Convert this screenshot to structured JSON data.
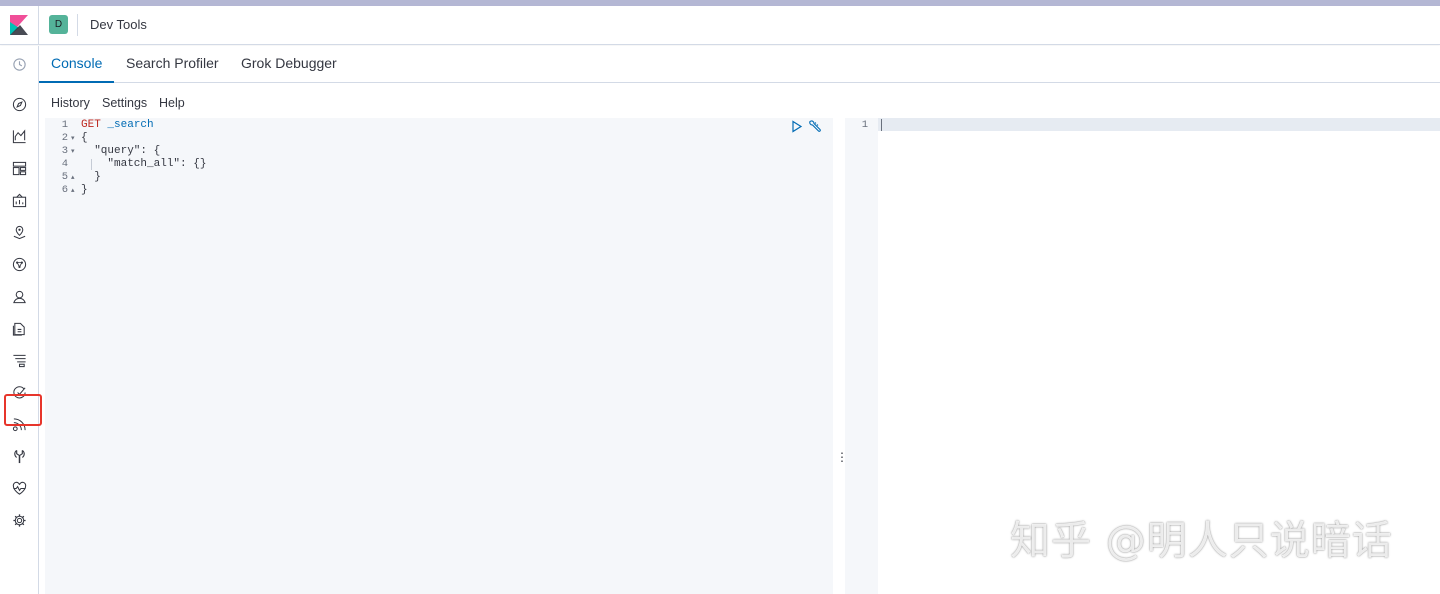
{
  "header": {
    "space_avatar": "D",
    "breadcrumb": "Dev Tools"
  },
  "sidenav": {
    "items": [
      {
        "icon": "recently-viewed-icon"
      },
      {
        "icon": "discover-icon"
      },
      {
        "icon": "visualize-icon"
      },
      {
        "icon": "dashboard-icon"
      },
      {
        "icon": "canvas-icon"
      },
      {
        "icon": "maps-icon"
      },
      {
        "icon": "ml-icon"
      },
      {
        "icon": "infrastructure-icon"
      },
      {
        "icon": "logs-icon"
      },
      {
        "icon": "apm-icon"
      },
      {
        "icon": "uptime-icon"
      },
      {
        "icon": "siem-icon"
      },
      {
        "icon": "dev-tools-icon"
      },
      {
        "icon": "monitoring-icon"
      },
      {
        "icon": "management-icon"
      }
    ],
    "highlighted_item": "dev-tools-icon",
    "highlight_color": "#e7352b"
  },
  "tabs": [
    {
      "label": "Console",
      "active": true
    },
    {
      "label": "Search Profiler",
      "active": false
    },
    {
      "label": "Grok Debugger",
      "active": false
    }
  ],
  "submenu": {
    "history": "History",
    "settings": "Settings",
    "help": "Help"
  },
  "request_editor": {
    "line_numbers": [
      "1",
      "2",
      "3",
      "4",
      "5",
      "6"
    ],
    "lines": [
      {
        "method": "GET",
        "path": " _search"
      },
      {
        "text": "{"
      },
      {
        "text": "  \"query\": {"
      },
      {
        "text": "    \"match_all\": {}"
      },
      {
        "text": "  }"
      },
      {
        "text": "}"
      }
    ]
  },
  "response_editor": {
    "line_numbers": [
      "1"
    ]
  },
  "watermark": "知乎 @明人只说暗话",
  "colors": {
    "accent": "#006bb4",
    "method": "#bd271e",
    "space_avatar_bg": "#54b399"
  }
}
